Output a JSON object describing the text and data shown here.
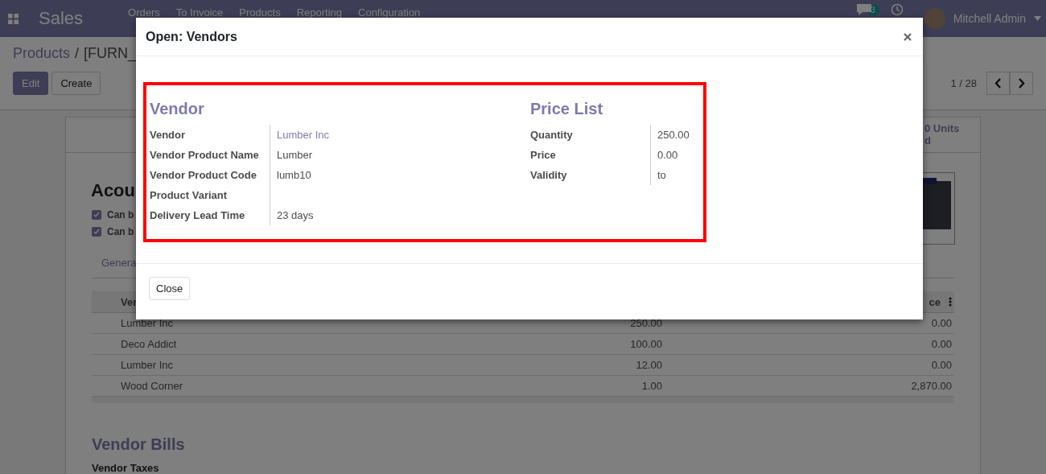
{
  "navbar": {
    "app_name": "Sales",
    "menu": [
      "Orders",
      "To Invoice",
      "Products",
      "Reporting",
      "Configuration"
    ],
    "notification_count": "3",
    "user_name": "Mitchell Admin"
  },
  "control_panel": {
    "breadcrumb": [
      "Products",
      "[FURN_"
    ],
    "separator": "/",
    "buttons": [
      {
        "label": "Edit",
        "kind": "primary"
      },
      {
        "label": "Create",
        "kind": "secondary"
      }
    ],
    "pager": "1 / 28"
  },
  "sheet": {
    "stat_button": {
      "value": "0 Units",
      "label": "d"
    },
    "title": "Acou",
    "checkboxes": [
      {
        "label": "Can b",
        "checked": true
      },
      {
        "label": "Can b",
        "checked": true
      }
    ],
    "tabs": [
      {
        "label": "Genera",
        "selected": false
      }
    ],
    "table": {
      "columns": [
        "Ver",
        "ce"
      ],
      "rows": [
        {
          "vendor": "Lumber Inc",
          "quantity": "250.00",
          "price": "0.00"
        },
        {
          "vendor": "Deco Addict",
          "quantity": "100.00",
          "price": "0.00"
        },
        {
          "vendor": "Lumber Inc",
          "quantity": "12.00",
          "price": "0.00"
        },
        {
          "vendor": "Wood Corner",
          "quantity": "1.00",
          "price": "2,870.00"
        }
      ]
    },
    "section_title": "Vendor Bills",
    "field_label": "Vendor Taxes"
  },
  "dialog": {
    "title": "Open: Vendors",
    "sections": [
      {
        "title": "Vendor",
        "fields": [
          {
            "label": "Vendor",
            "value": "Lumber Inc",
            "kind": "link"
          },
          {
            "label": "Vendor Product Name",
            "value": "Lumber",
            "kind": "text"
          },
          {
            "label": "Vendor Product Code",
            "value": "lumb10",
            "kind": "text"
          },
          {
            "label": "Product Variant",
            "kind": "text"
          },
          {
            "label": "Delivery Lead Time",
            "value": "23 days",
            "kind": "text"
          }
        ]
      },
      {
        "title": "Price List",
        "fields": [
          {
            "label": "Quantity",
            "value": "250.00",
            "kind": "text"
          },
          {
            "label": "Price",
            "value": "0.00",
            "kind": "text"
          },
          {
            "label": "Validity",
            "value": "to",
            "kind": "text"
          }
        ]
      }
    ],
    "buttons": [
      "Close"
    ]
  }
}
